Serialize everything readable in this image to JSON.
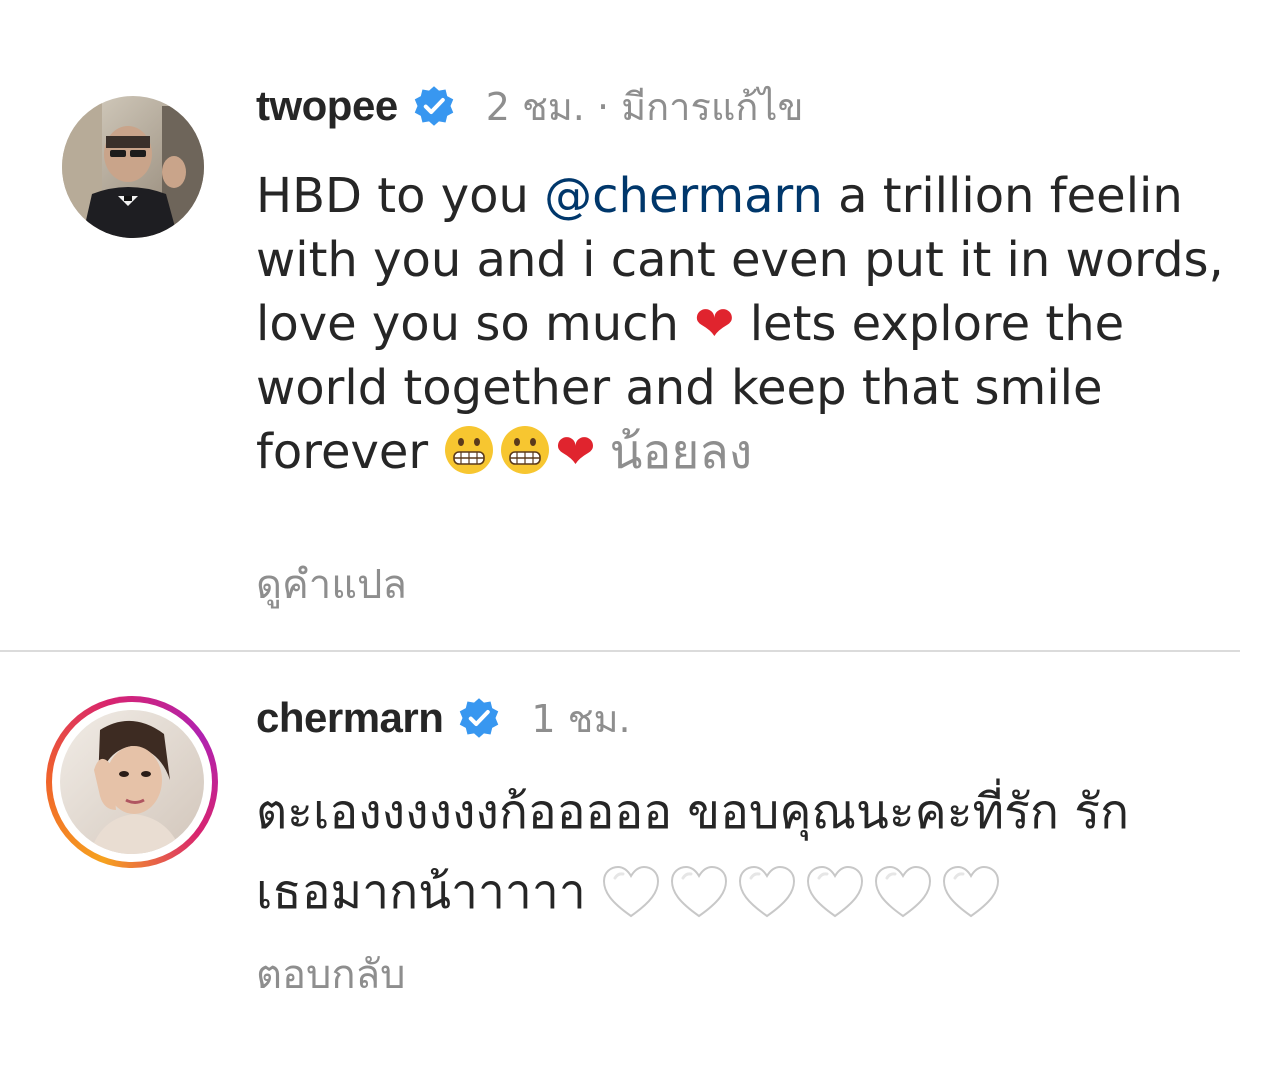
{
  "comments": [
    {
      "username": "twopee",
      "verified": true,
      "meta": "2 ชม. · มีการแก้ไข",
      "text_part1": "HBD to you ",
      "mention": "@chermarn",
      "text_part2": " a trillion feelin with you and i cant even put it in words, love you so much ",
      "emoji_heart_1": "❤",
      "text_part3": " lets explore the world together and keep that smile forever ",
      "emoji_trailing": [
        "grimacing-face",
        "grimacing-face",
        "red-heart"
      ],
      "emoji_heart_2": "❤",
      "see_less": "น้อยลง",
      "action": "ดูคำแปล",
      "avatar_icon": "profile-photo"
    },
    {
      "username": "chermarn",
      "verified": true,
      "meta": "1 ชม.",
      "text": "ตะเองงงงงงก้อออออ ขอบคุณนะคะที่รัก รักเธอมากน้าาาาา",
      "emoji_trailing": [
        "white-heart",
        "white-heart",
        "white-heart",
        "white-heart",
        "white-heart",
        "white-heart"
      ],
      "action": "ตอบกลับ",
      "avatar_icon": "profile-photo-story-ring"
    }
  ],
  "colors": {
    "text": "#262626",
    "muted": "#8e8e8e",
    "mention": "#00376b",
    "verified": "#3897f0",
    "heart": "#e0242e",
    "divider": "#dbdbdb"
  }
}
